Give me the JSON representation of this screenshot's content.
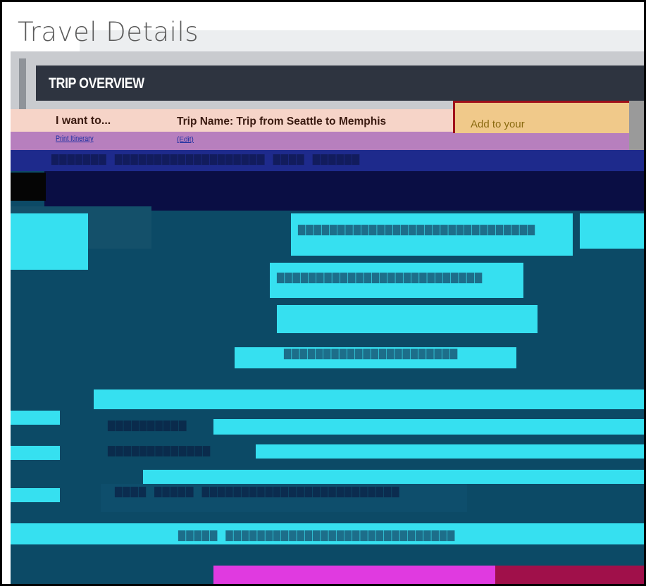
{
  "page": {
    "title": "Travel Details"
  },
  "panel": {
    "title": "TRIP OVERVIEW"
  },
  "actions": {
    "label": "I want to...",
    "print_itinerary": "Print Itinerary"
  },
  "trip": {
    "name_label": "Trip Name: Trip from Seattle to Memphis",
    "edit_link": "(Edit)"
  },
  "itinerary": {
    "add_label": "Add to your"
  },
  "colors": {
    "header_bg": "#2e3440",
    "trip_row_bg": "#f6d4c8",
    "link": "#1a2ea0",
    "add_button_bg": "#f0c98a"
  },
  "icons": {
    "panel_header": "none"
  }
}
